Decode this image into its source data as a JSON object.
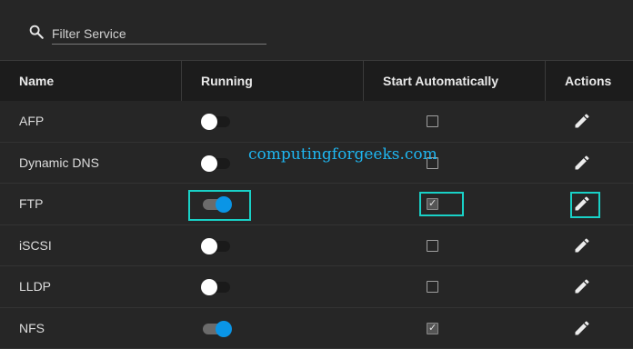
{
  "search": {
    "placeholder": "Filter Service"
  },
  "table": {
    "headers": {
      "name": "Name",
      "running": "Running",
      "start_auto": "Start Automatically",
      "actions": "Actions"
    },
    "rows": [
      {
        "name": "AFP",
        "running": false,
        "start_auto": false
      },
      {
        "name": "Dynamic DNS",
        "running": false,
        "start_auto": false
      },
      {
        "name": "FTP",
        "running": true,
        "start_auto": true
      },
      {
        "name": "iSCSI",
        "running": false,
        "start_auto": false
      },
      {
        "name": "LLDP",
        "running": false,
        "start_auto": false
      },
      {
        "name": "NFS",
        "running": true,
        "start_auto": true
      }
    ]
  },
  "watermark": "computingforgeeks.com",
  "colors": {
    "toggle_on": "#0a95e6",
    "highlight": "#19d1c7",
    "watermark": "#1fb6f0"
  },
  "icons": {
    "search": "search-icon",
    "edit": "pencil-icon",
    "check": "check-icon"
  }
}
